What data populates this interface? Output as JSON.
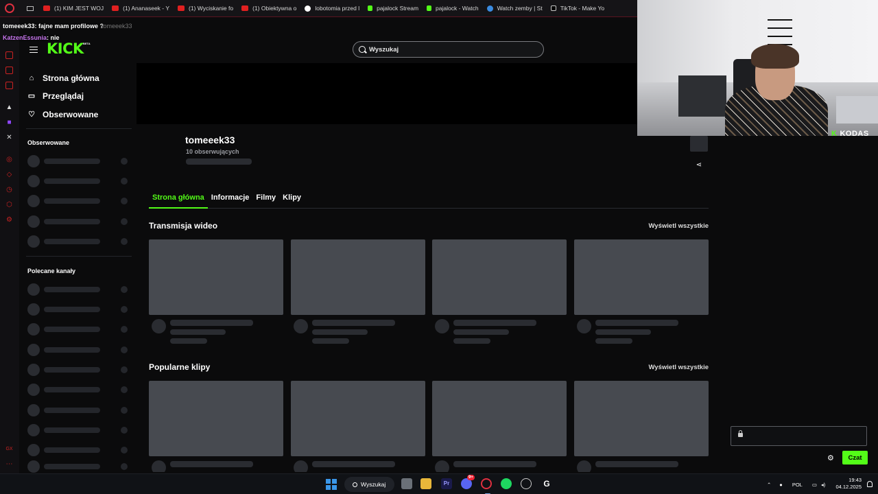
{
  "browser": {
    "tabs": [
      {
        "label": "(1) KIM JEST WOJ",
        "favicon": "youtube-icon"
      },
      {
        "label": "(1) Ananaseek - Y",
        "favicon": "youtube-icon"
      },
      {
        "label": "(1) Wyciskanie fo",
        "favicon": "youtube-icon"
      },
      {
        "label": "(1) Obiektywna o",
        "favicon": "youtube-icon"
      },
      {
        "label": "lobotomia przed l",
        "favicon": "google-icon"
      },
      {
        "label": "pajalock Stream",
        "favicon": "kick-icon"
      },
      {
        "label": "pajalock - Watch",
        "favicon": "kick-icon"
      },
      {
        "label": "Watch zemby | St",
        "favicon": "web-icon"
      },
      {
        "label": "TikTok - Make Yo",
        "favicon": "tiktok-icon"
      }
    ]
  },
  "chat_overlay": {
    "line1_user": "tomeeek33",
    "line1_text": ": fajne mam profilowe ?",
    "line1_ghost": "tomeeek33",
    "line2_user": "KatzenEssunia",
    "line2_text": ": nie"
  },
  "kick": {
    "logo": "KICK",
    "logo_badge": "BETA",
    "search_placeholder": "Wyszukaj",
    "nav": [
      {
        "label": "Strona główna",
        "icon": "home-icon"
      },
      {
        "label": "Przeglądaj",
        "icon": "browse-icon"
      },
      {
        "label": "Obserwowane",
        "icon": "heart-icon"
      }
    ],
    "followed_title": "Obserwowane",
    "recommended_title": "Polecane kanały"
  },
  "channel": {
    "name": "tomeeek33",
    "followers": "10 obserwujących",
    "tabs": [
      "Strona główna",
      "Informacje",
      "Filmy",
      "Klipy"
    ],
    "active_tab": "Strona główna",
    "sections": [
      {
        "title": "Transmisja wideo",
        "view_all": "Wyświetl wszystkie"
      },
      {
        "title": "Popularne klipy",
        "view_all": "Wyświetl wszystkie"
      }
    ]
  },
  "webcam": {
    "brand_mark": "K",
    "brand": "KODAS"
  },
  "chat": {
    "send_label": "Czat"
  },
  "taskbar": {
    "search_label": "Wyszukaj",
    "language": "POL",
    "time": "19:43",
    "date": "04.12.2025",
    "discord_badge": "9+"
  },
  "colors": {
    "kick_green": "#53fc18",
    "background": "#0b0b0c",
    "skeleton": "#474a50",
    "opera_red": "#e03040"
  }
}
